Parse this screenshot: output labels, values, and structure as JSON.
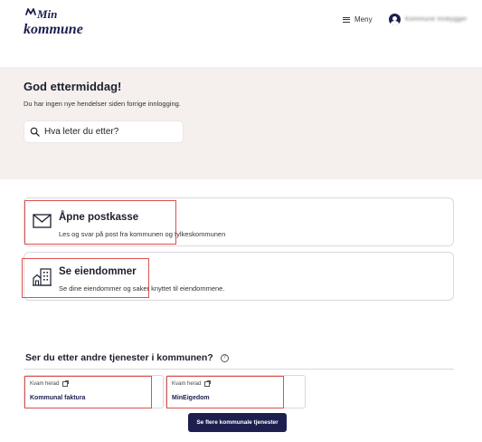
{
  "header": {
    "logo_line1": "Min",
    "logo_line2": "kommune",
    "menu_label": "Meny",
    "user_name": "Kommune Innbygger"
  },
  "hero": {
    "greeting": "God ettermiddag!",
    "subtitle": "Du har ingen nye hendelser siden forrige innlogging.",
    "search_placeholder": "Hva leter du etter?"
  },
  "cards": [
    {
      "icon": "envelope-icon",
      "title": "Åpne postkasse",
      "description": "Les og svar på post fra kommunen og fylkeskommunen"
    },
    {
      "icon": "buildings-icon",
      "title": "Se eiendommer",
      "description": "Se dine eiendommer og saker knyttet til eiendommene."
    }
  ],
  "services": {
    "title": "Ser du etter andre tjenester i kommunen?",
    "items": [
      {
        "municipality": "Kvam herad",
        "name": "Kommunal faktura"
      },
      {
        "municipality": "Kvam herad",
        "name": "MinEigedom"
      }
    ],
    "more_button": "Se flere kommunale tjenester"
  },
  "colors": {
    "navy": "#1d1f4f",
    "hero_bg": "#f5f0ee",
    "highlight": "#d9534f"
  }
}
